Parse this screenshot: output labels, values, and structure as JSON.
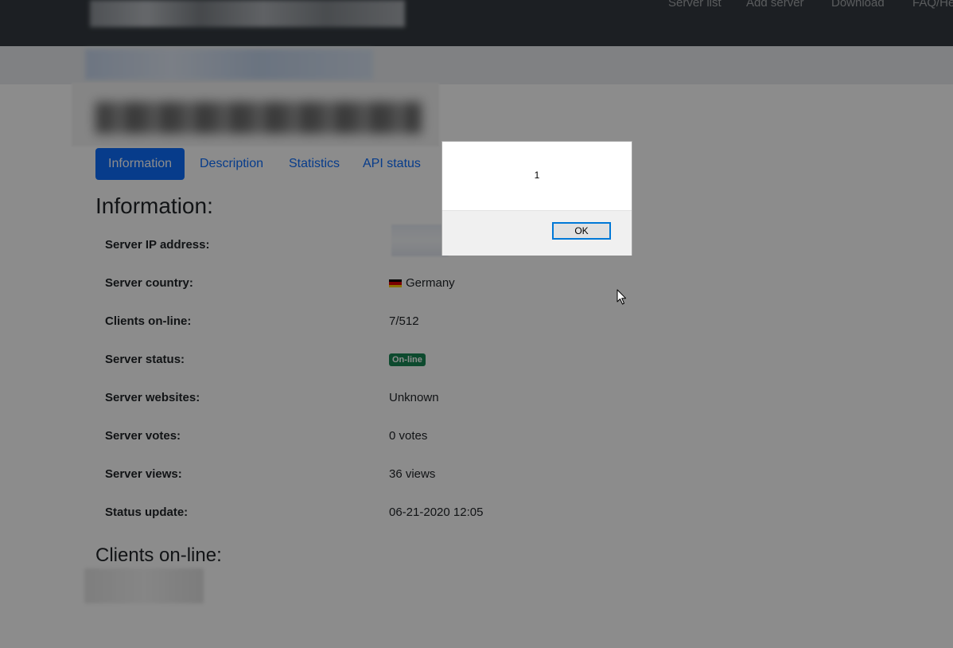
{
  "nav": {
    "links": [
      "Server list",
      "Add server",
      "Download",
      "FAQ/He"
    ]
  },
  "tabs": [
    "Information",
    "Description",
    "Statistics",
    "API status"
  ],
  "info": {
    "heading": "Information:",
    "rows": [
      {
        "label": "Server IP address:",
        "value": ""
      },
      {
        "label": "Server country:",
        "value": "Germany"
      },
      {
        "label": "Clients on-line:",
        "value": "7/512"
      },
      {
        "label": "Server status:",
        "value": "On-line"
      },
      {
        "label": "Server websites:",
        "value": "Unknown"
      },
      {
        "label": "Server votes:",
        "value": "0 votes"
      },
      {
        "label": "Server views:",
        "value": "36 views"
      },
      {
        "label": "Status update:",
        "value": "06-21-2020 12:05"
      }
    ]
  },
  "clients": {
    "heading": "Clients on-line:"
  },
  "dialog": {
    "message": "1",
    "ok_label": "OK"
  },
  "colors": {
    "navbar": "#343a40",
    "primary": "#0d6efd",
    "success": "#198754",
    "focus_border": "#0078d7"
  },
  "icons": {
    "country_flag": "germany-flag-icon",
    "cursor": "mouse-pointer-icon"
  }
}
